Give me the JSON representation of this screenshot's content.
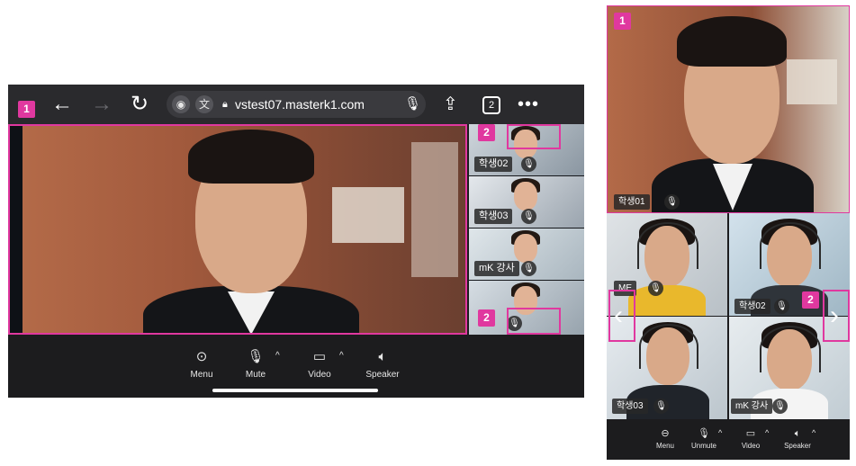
{
  "landscape": {
    "browser": {
      "url": "vstest07.masterk1.com",
      "tab_count": "2",
      "back_icon": "arrow-left-icon",
      "forward_icon": "arrow-right-icon",
      "reload_icon": "reload-icon",
      "share_icon": "share-icon",
      "more_icon": "more-dots-icon"
    },
    "participants": [
      {
        "name": "학생02",
        "muted": true
      },
      {
        "name": "학생03",
        "muted": true
      },
      {
        "name": "mK 강사",
        "muted": true
      },
      {
        "name": "",
        "muted": true
      }
    ],
    "controls": [
      {
        "label": "Menu",
        "icon": "menu-dots-icon"
      },
      {
        "label": "Mute",
        "icon": "microphone-icon"
      },
      {
        "label": "Video",
        "icon": "camera-icon"
      },
      {
        "label": "Speaker",
        "icon": "speaker-icon"
      }
    ],
    "badges": [
      "1",
      "2",
      "2"
    ]
  },
  "portrait": {
    "main_participant": {
      "name": "학생01",
      "muted": true
    },
    "grid": [
      {
        "name": "ME",
        "muted": true
      },
      {
        "name": "학생02",
        "muted": true
      },
      {
        "name": "학생03",
        "muted": true
      },
      {
        "name": "mK 강사",
        "muted": true
      }
    ],
    "controls": [
      {
        "label": "Menu",
        "icon": "menu-dots-icon"
      },
      {
        "label": "Unmute",
        "icon": "microphone-off-icon"
      },
      {
        "label": "Video",
        "icon": "camera-icon"
      },
      {
        "label": "Speaker",
        "icon": "speaker-icon"
      }
    ],
    "badges": [
      "1",
      "2",
      "2"
    ]
  },
  "colors": {
    "highlight": "#e0389f",
    "app_bg": "#1c1c1e",
    "brick": "#a25a3d"
  }
}
